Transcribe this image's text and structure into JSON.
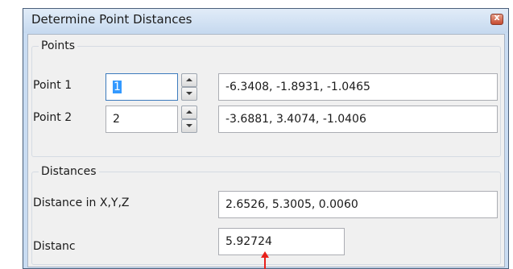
{
  "window": {
    "title": "Determine Point Distances",
    "close_label": "x"
  },
  "points_group": {
    "legend": "Points",
    "point1": {
      "label": "Point 1",
      "index": "1",
      "coords": "-6.3408, -1.8931, -1.0465"
    },
    "point2": {
      "label": "Point 2",
      "index": "2",
      "coords": "-3.6881, 3.4074, -1.0406"
    }
  },
  "distances_group": {
    "legend": "Distances",
    "xyz_label": "Distance in X,Y,Z",
    "xyz_value": "2.6526, 5.3005, 0.0060",
    "distance_label": "Distanc",
    "distance_value": "5.92724"
  },
  "colors": {
    "annotation_arrow": "#e8201a",
    "selection": "#3399ff"
  }
}
